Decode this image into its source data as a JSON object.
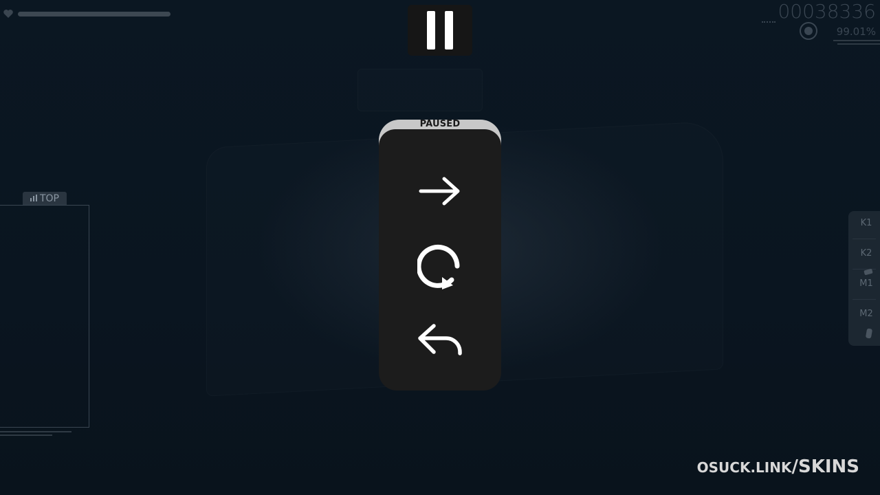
{
  "hud": {
    "health_fraction": 1.0,
    "score": "00038336",
    "accuracy": "99.01%"
  },
  "pause_menu": {
    "title": "PAUSED",
    "buttons": [
      {
        "name": "continue",
        "icon": "arrow-right-icon"
      },
      {
        "name": "retry",
        "icon": "retry-icon"
      },
      {
        "name": "back",
        "icon": "back-arrow-icon"
      }
    ]
  },
  "leaderboard": {
    "title": "TOP",
    "icon": "bar-chart-icon"
  },
  "key_overlay": {
    "keys": [
      "K1",
      "K2",
      "M1",
      "M2"
    ]
  },
  "watermark": {
    "site": "OSUCK.LINK",
    "path": "/SKINS"
  },
  "colors": {
    "background": "#0a1520",
    "menu_body": "#1c1c1c",
    "menu_header": "#c8c8c8",
    "icon": "#ffffff",
    "hud_dim": "#3a4652"
  }
}
